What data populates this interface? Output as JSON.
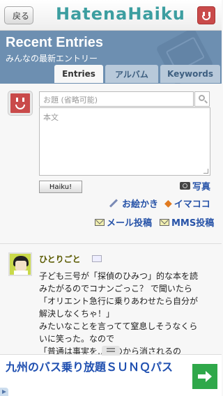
{
  "topbar": {
    "back_label": "戻る",
    "logo": "HatenaHaiku"
  },
  "header": {
    "title": "Recent Entries",
    "subtitle": "みんなの最新エントリー",
    "tabs": [
      {
        "label": "Entries",
        "active": true
      },
      {
        "label": "アルバム"
      },
      {
        "label": "Keywords"
      }
    ]
  },
  "form": {
    "title_placeholder": "お題 (省略可能)",
    "body_placeholder": "本文",
    "submit_label": "Haiku!",
    "photo_label": "写真",
    "draw_label": "お絵かき",
    "imacoco_label": "イマココ",
    "mail_label": "メール投稿",
    "mms_label": "MMS投稿"
  },
  "entry": {
    "title": "ひとりごと",
    "lines": [
      "子ども三号が「探偵のひみつ」的な本を読",
      "みたがるのでコナンごっこ？ で聞いたら",
      "「オリエント急行に乗りあわせたら自分が",
      "解決しなくちゃ！」",
      "みたいなことを言ってて窒息しそうなくら",
      "いに笑った。なので",
      "「普通は事実を…たのから消されるの"
    ]
  },
  "ad": {
    "text": "九州のバス乗り放題ＳＵＮＱパス"
  },
  "colors": {
    "header_bg": "#6d8fb1",
    "logo": "#3c9ea0",
    "link": "#2753a8",
    "avatar_red": "#c94a4a",
    "ad_green": "#2fa84a"
  }
}
